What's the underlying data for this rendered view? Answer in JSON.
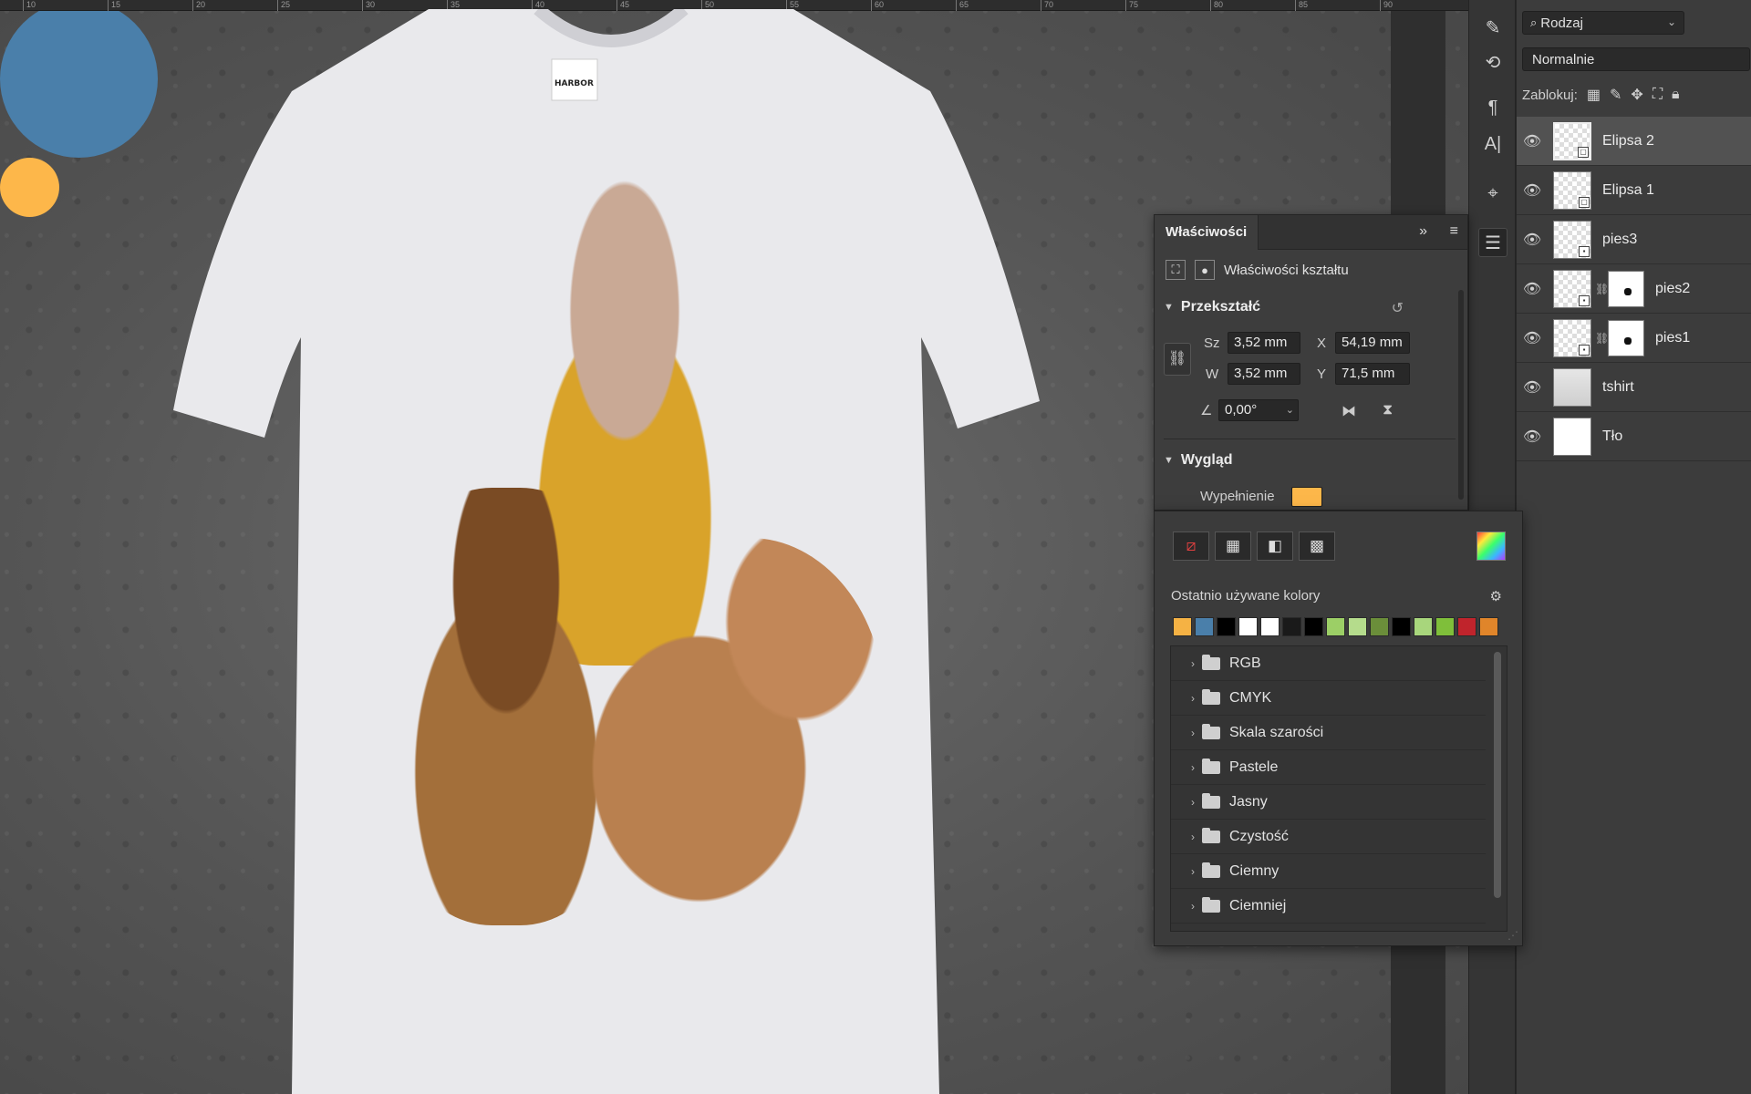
{
  "ruler": {
    "ticks": [
      "10",
      "15",
      "20",
      "25",
      "30",
      "35",
      "40",
      "45",
      "50",
      "55",
      "60",
      "65",
      "70",
      "75",
      "80",
      "85",
      "90"
    ]
  },
  "tools": {
    "icons": [
      "brush-icon",
      "history-brush-icon",
      "paragraph-icon",
      "character-icon",
      "path-selection-icon",
      "adjustments-icon"
    ],
    "glyphs": [
      "✎",
      "⟲",
      "¶",
      "A|",
      "⌖",
      "☰"
    ]
  },
  "layers": {
    "filter_label": "Rodzaj",
    "blend_mode": "Normalnie",
    "lock_label": "Zablokuj:",
    "items": [
      {
        "name": "Elipsa 2",
        "type": "shape",
        "selected": true
      },
      {
        "name": "Elipsa 1",
        "type": "shape",
        "selected": false
      },
      {
        "name": "pies3",
        "type": "smart",
        "selected": false
      },
      {
        "name": "pies2",
        "type": "masked",
        "selected": false
      },
      {
        "name": "pies1",
        "type": "masked",
        "selected": false
      },
      {
        "name": "tshirt",
        "type": "image",
        "selected": false
      },
      {
        "name": "Tło",
        "type": "background",
        "selected": false
      }
    ]
  },
  "properties": {
    "tab_label": "Właściwości",
    "shape_title": "Właściwości kształtu",
    "transform_label": "Przekształć",
    "width_label": "Sz",
    "width_value": "3,52 mm",
    "height_label": "W",
    "height_value": "3,52 mm",
    "x_label": "X",
    "x_value": "54,19 mm",
    "y_label": "Y",
    "y_value": "71,5 mm",
    "angle_value": "0,00°",
    "appearance_label": "Wygląd",
    "fill_label": "Wypełnienie",
    "fill_color": "#fdb74a"
  },
  "picker": {
    "recent_label": "Ostatnio używane kolory",
    "recent_colors": [
      "#f5b244",
      "#4a7faa",
      "#000000",
      "#ffffff",
      "#ffffff",
      "#1a1a1a",
      "#000000",
      "#9ccf66",
      "#b5dc8c",
      "#6b8e3a",
      "#000000",
      "#a8d67c",
      "#7fbf3a",
      "#c0242c",
      "#e0852a"
    ],
    "folders": [
      "RGB",
      "CMYK",
      "Skala szarości",
      "Pastele",
      "Jasny",
      "Czystość",
      "Ciemny",
      "Ciemniej"
    ]
  },
  "canvas": {
    "blue_circle_color": "#4a7faa",
    "orange_circle_color": "#fdb74a",
    "shirt_label": "HARBOR"
  }
}
